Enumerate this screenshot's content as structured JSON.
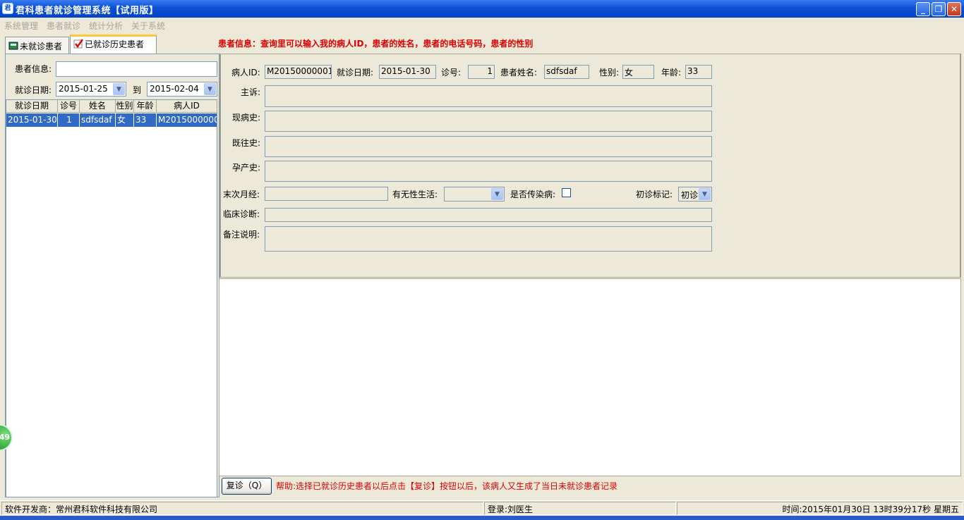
{
  "window": {
    "title": "君科患者就诊管理系统【试用版】",
    "icon": "app-icon",
    "min": "_",
    "restore": "❐",
    "close": "✕"
  },
  "menu": [
    "系统管理",
    "患者就诊",
    "统计分析",
    "关于系统"
  ],
  "tabs": {
    "pending": "未就诊患者",
    "history": "已就诊历史患者"
  },
  "heading": "患者信息：查询里可以输入我的病人ID，患者的姓名，患者的电话号码，患者的性别",
  "filter": {
    "patient_info_label": "患者信息:",
    "patient_info_value": "",
    "date_label": "就诊日期:",
    "date_from": "2015-01-25",
    "to_label": "到",
    "date_to": "2015-02-04"
  },
  "table": {
    "columns": [
      "就诊日期",
      "诊号",
      "姓名",
      "性别",
      "年龄",
      "病人ID"
    ],
    "rows": [
      [
        "2015-01-30",
        "1",
        "sdfsdaf",
        "女",
        "33",
        "M20150000001"
      ]
    ]
  },
  "form": {
    "patient_id_label": "病人ID:",
    "patient_id": "M20150000001",
    "visit_date_label": "就诊日期:",
    "visit_date": "2015-01-30",
    "visit_no_label": "诊号:",
    "visit_no": "1",
    "name_label": "患者姓名:",
    "name": "sdfsdaf",
    "gender_label": "性别:",
    "gender": "女",
    "age_label": "年龄:",
    "age": "33",
    "chief_complaint_label": "主诉:",
    "present_illness_label": "现病史:",
    "past_history_label": "既往史:",
    "obstetric_history_label": "孕产史:",
    "lmp_label": "末次月经:",
    "sexual_life_label": "有无性生活:",
    "infectious_label": "是否传染病:",
    "first_visit_label": "初诊标记:",
    "first_visit_value": "初诊",
    "diagnosis_label": "临床诊断:",
    "notes_label": "备注说明:"
  },
  "revisit_button": "复诊（Q）",
  "help_text": "帮助:选择已就诊历史患者以后点击【复诊】按钮以后，该病人又生成了当日未就诊患者记录",
  "status": {
    "developer": "软件开发商：常州君科软件科技有限公司",
    "login": "登录:刘医生",
    "time": "时间:2015年01月30日  13时39分17秒  星期五"
  },
  "gadget_badge": "49",
  "colors": {
    "title_bar": "#0a4fd4",
    "selection": "#316ac5",
    "heading": "#e00000"
  }
}
